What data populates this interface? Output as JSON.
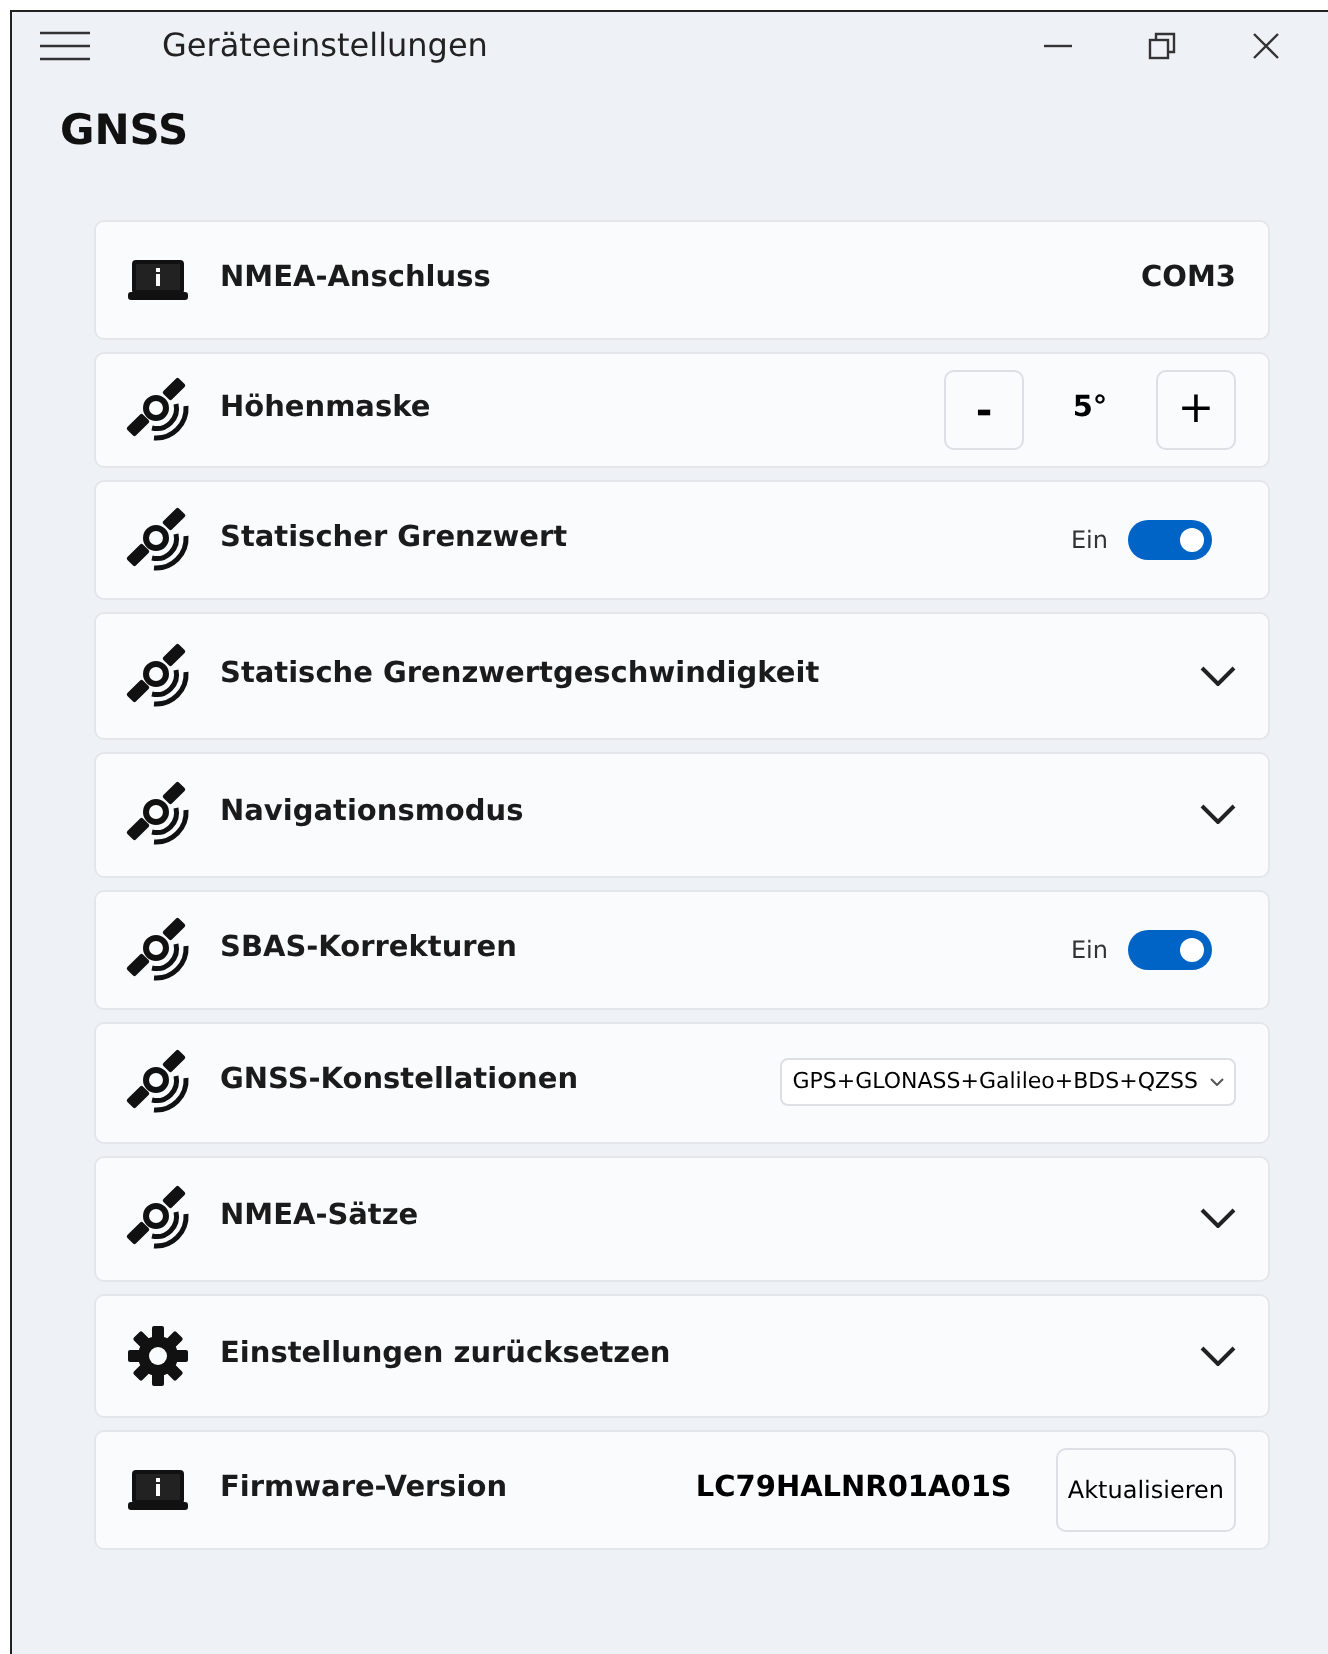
{
  "window": {
    "title": "Geräteeinstellungen"
  },
  "page_title": "GNSS",
  "settings": [
    {
      "kind": "value",
      "label": "NMEA-Anschluss",
      "value": "COM3"
    },
    {
      "kind": "stepper",
      "label": "Höhenmaske",
      "value": "5°",
      "minus": "-",
      "plus": "+"
    },
    {
      "kind": "toggle",
      "label": "Statischer Grenzwert",
      "state_label": "Ein",
      "on": true
    },
    {
      "kind": "expander",
      "label": "Statische Grenzwertgeschwindigkeit",
      "expanded": false
    },
    {
      "kind": "expander",
      "label": "Navigationsmodus",
      "expanded": false
    },
    {
      "kind": "toggle",
      "label": "SBAS-Korrekturen",
      "state_label": "Ein",
      "on": true
    },
    {
      "kind": "select",
      "label": "GNSS-Konstellationen",
      "value": "GPS+GLONASS+Galileo+BDS+QZSS"
    },
    {
      "kind": "expander",
      "label": "NMEA-Sätze",
      "expanded": false
    },
    {
      "kind": "expander",
      "label": "Einstellungen zurücksetzen",
      "expanded": false
    },
    {
      "kind": "button",
      "label": "Firmware-Version",
      "value": "LC79HALNR01A01S",
      "button": "Aktualisieren"
    }
  ]
}
